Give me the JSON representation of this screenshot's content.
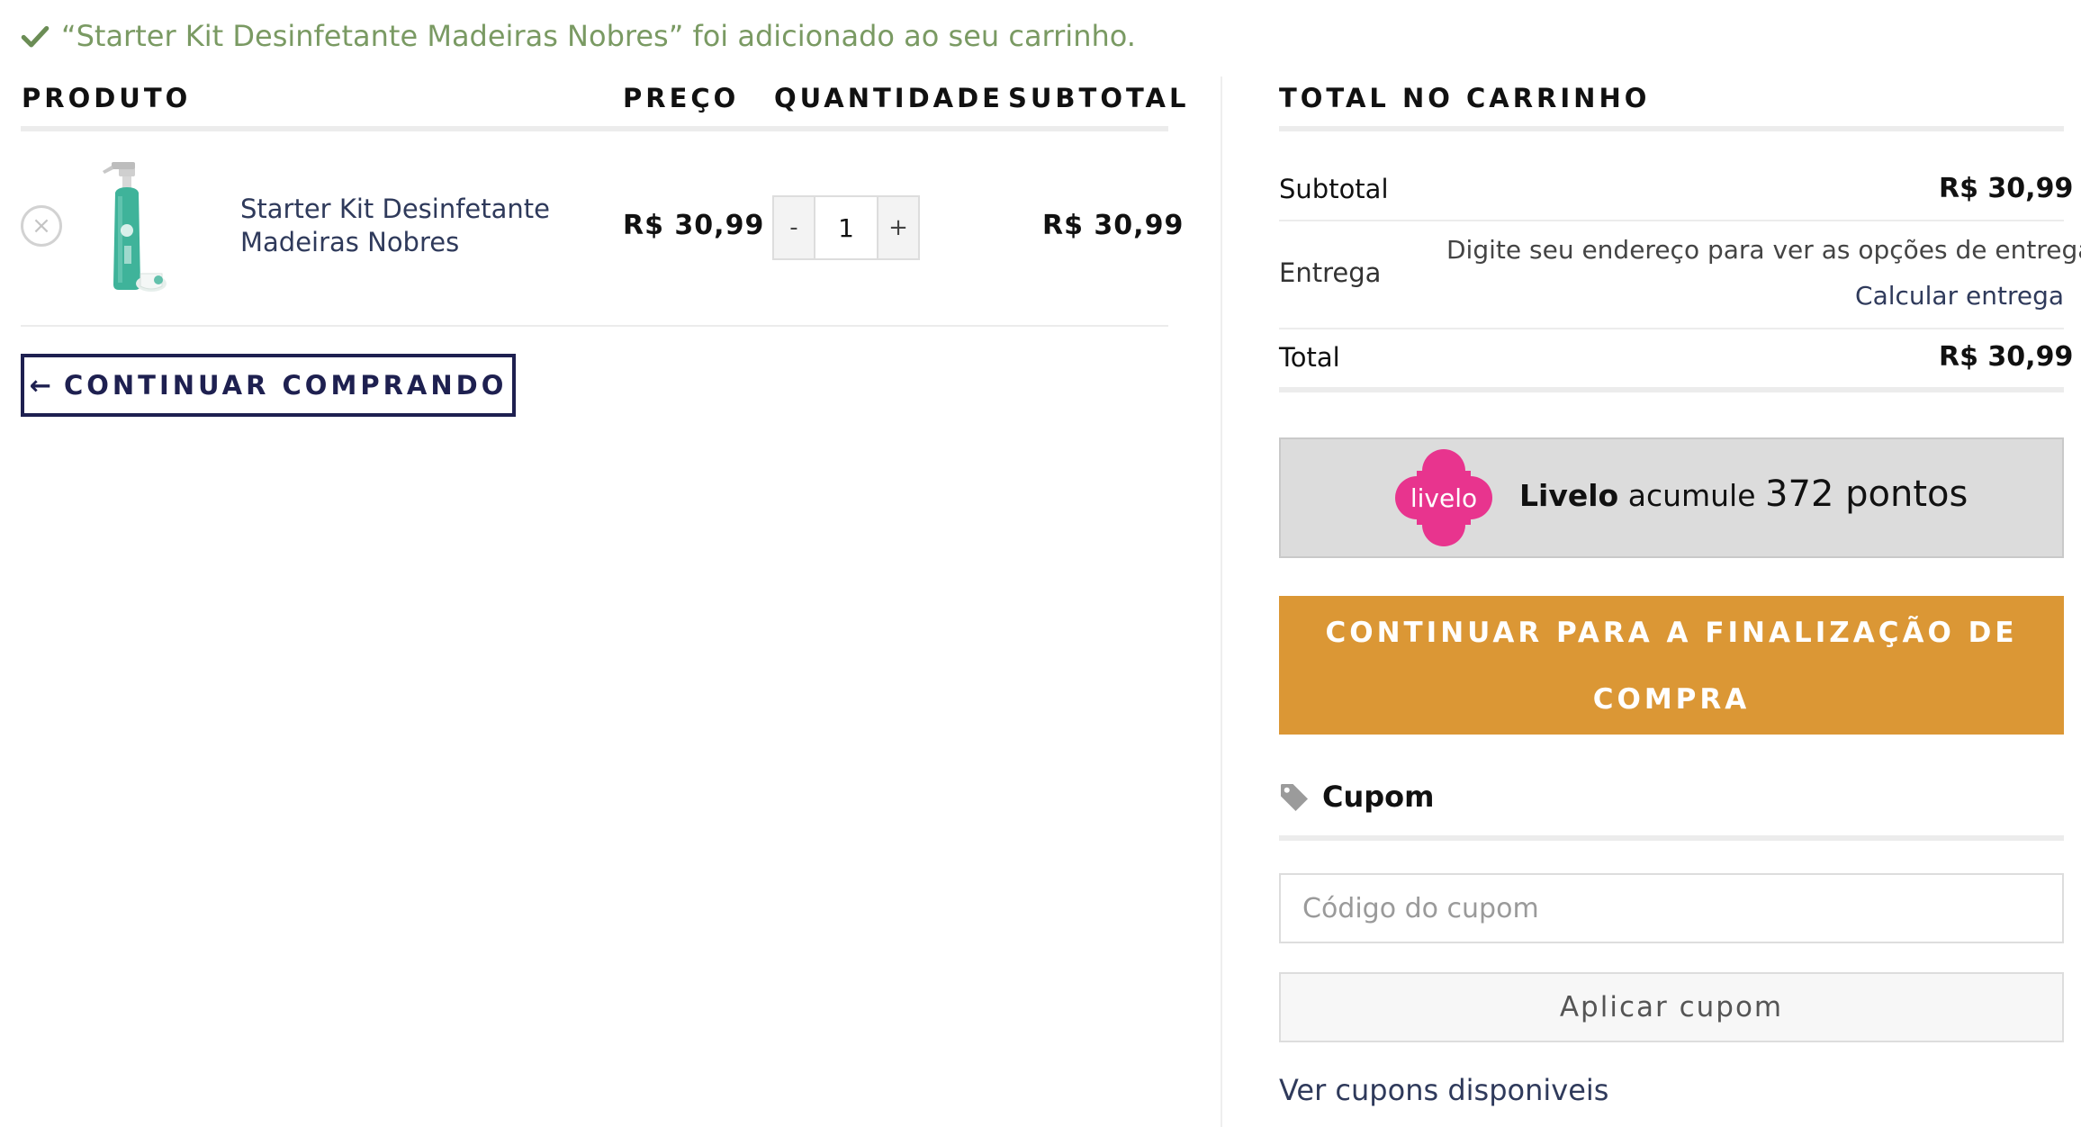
{
  "notice": {
    "text": "“Starter Kit Desinfetante Madeiras Nobres” foi adicionado ao seu carrinho."
  },
  "cart_table": {
    "headers": {
      "product": "PRODUTO",
      "price": "PREÇO",
      "quantity": "QUANTIDADE",
      "subtotal": "SUBTOTAL"
    },
    "items": [
      {
        "name": "Starter Kit Desinfetante Madeiras Nobres",
        "price": "R$ 30,99",
        "quantity": "1",
        "subtotal": "R$ 30,99"
      }
    ],
    "qty_minus": "-",
    "qty_plus": "+",
    "remove_symbol": "×"
  },
  "continue_shopping": {
    "arrow": "←",
    "label": "CONTINUAR COMPRANDO"
  },
  "totals": {
    "title": "TOTAL NO CARRINHO",
    "subtotal_label": "Subtotal",
    "subtotal_value": "R$ 30,99",
    "shipping_label": "Entrega",
    "shipping_info": "Digite seu endereço para ver as opções de entrega.",
    "shipping_link": "Calcular entrega",
    "total_label": "Total",
    "total_value": "R$ 30,99"
  },
  "livelo": {
    "logo_text": "livelo",
    "brand": "Livelo",
    "text": "acumule",
    "points": "372 pontos",
    "logo_color": "#e8348e"
  },
  "checkout": {
    "label": "CONTINUAR PARA A FINALIZAÇÃO DE COMPRA",
    "color": "#db9735"
  },
  "coupon": {
    "title": "Cupom",
    "placeholder": "Código do cupom",
    "apply_label": "Aplicar cupom",
    "view_link": "Ver cupons disponiveis"
  },
  "colors": {
    "navy": "#1e2050",
    "success": "#7a9a63"
  }
}
